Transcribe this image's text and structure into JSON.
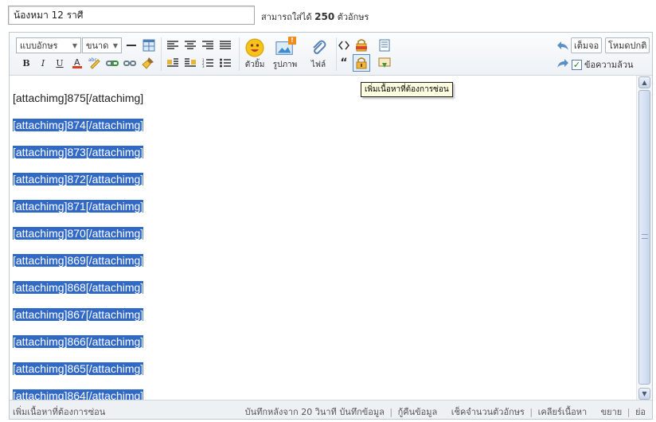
{
  "subject": {
    "value": "น้องหมา 12 ราศี",
    "limit_prefix": "สามารถใส่ได้",
    "limit_count": "250",
    "limit_suffix": "ตัวอักษร"
  },
  "toolbar": {
    "font_select": "แบบอักษร",
    "size_select": "ขนาด",
    "bold": "B",
    "italic": "I",
    "underline": "U",
    "emoticon_label": "ตัวยิ้ม",
    "image_label": "รูปภาพ",
    "file_label": "ไฟล์",
    "image_badge": "!",
    "fullscreen_label": "เต็มจอ",
    "normal_mode_label": "โหมดปกติ",
    "plaintext_label": "ข้อความล้วน",
    "quote_glyph": "“"
  },
  "content": {
    "lines": [
      "[attachimg]875[/attachimg]",
      "[attachimg]874[/attachimg]",
      "[attachimg]873[/attachimg]",
      "[attachimg]872[/attachimg]",
      "[attachimg]871[/attachimg]",
      "[attachimg]870[/attachimg]",
      "[attachimg]869[/attachimg]",
      "[attachimg]868[/attachimg]",
      "[attachimg]867[/attachimg]",
      "[attachimg]866[/attachimg]",
      "[attachimg]865[/attachimg]",
      "[attachimg]864[/attachimg]"
    ],
    "selection_color": "#3169c6"
  },
  "tooltip": "เพิ่มเนื้อหาที่ต้องการซ่อน",
  "statusbar": {
    "left": "เพิ่มเนื้อหาที่ต้องการซ่อน",
    "autosave": "บันทึกหลังจาก 20 วินาที",
    "save_data": "บันทึกข้อมูล",
    "restore_data": "กู้คืนข้อมูล",
    "check_length": "เช็คจำนวนตัวอักษร",
    "clear_content": "เคลียร์เนื้อหา",
    "expand": "ขยาย",
    "shrink": "ย่อ"
  }
}
